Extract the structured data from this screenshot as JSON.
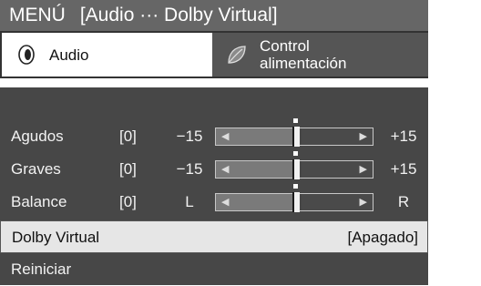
{
  "title": {
    "main": "MENÚ",
    "breadcrumb": "[Audio ··· Dolby Virtual]"
  },
  "tabs": [
    {
      "label": "Audio",
      "icon": "audio-icon",
      "active": true
    },
    {
      "label_line1": "Control",
      "label_line2": "alimentación",
      "icon": "leaf-icon",
      "active": false
    }
  ],
  "sliders": [
    {
      "label": "Agudos",
      "value": "[0]",
      "min_label": "−15",
      "max_label": "+15",
      "level": 0.5
    },
    {
      "label": "Graves",
      "value": "[0]",
      "min_label": "−15",
      "max_label": "+15",
      "level": 0.5
    },
    {
      "label": "Balance",
      "value": "[0]",
      "min_label": "L",
      "max_label": "R",
      "level": 0.5
    }
  ],
  "options": [
    {
      "label": "Dolby Virtual",
      "value": "[Apagado]",
      "selected": true
    },
    {
      "label": "Reiniciar",
      "selected": false
    }
  ],
  "colors": {
    "title_bar": "#666666",
    "panel": "#474747",
    "selected_row": "#e6e6e6"
  }
}
